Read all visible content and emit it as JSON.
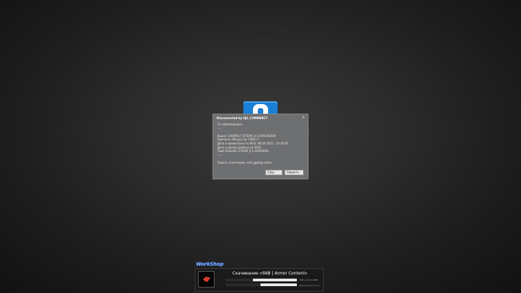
{
  "dialog": {
    "title": "Disconnected by GJC_COMMERCT",
    "close_symbol": "×",
    "lines": [
      "Ты заблокирован",
      "----",
      "",
      "Выдал: 1000Plu7 (STEAM_0:1:594136200)",
      "Причина: Обход ji by 1000+7",
      "Дата и время бана по МСК: 08.04.2025 - 14:34:05",
      "Дата и время разбана по МСК:",
      "Твой SteamID: STEAM_0:1:45993094",
      "----",
      "",
      "Подать апелляцию: vcts.gg/dsg-urban"
    ],
    "copy_label": "Copy",
    "close_label": "Закрыть"
  },
  "download": {
    "brand": "WorkShop",
    "title": "Скачивание «SNB | Armor Content»",
    "progress_1": 0.38,
    "progress_2": 0.49,
    "status": "38% из 31.19 MB",
    "substatus": "Дополнение 3 из 4"
  },
  "colors": {
    "logo_blue": "#1a7fd6",
    "dialog_bg": "#6e6f71"
  },
  "icons": {
    "app_logo": "gmod-logo-icon",
    "addon_thumbnail": "addon-thumbnail-icon"
  }
}
